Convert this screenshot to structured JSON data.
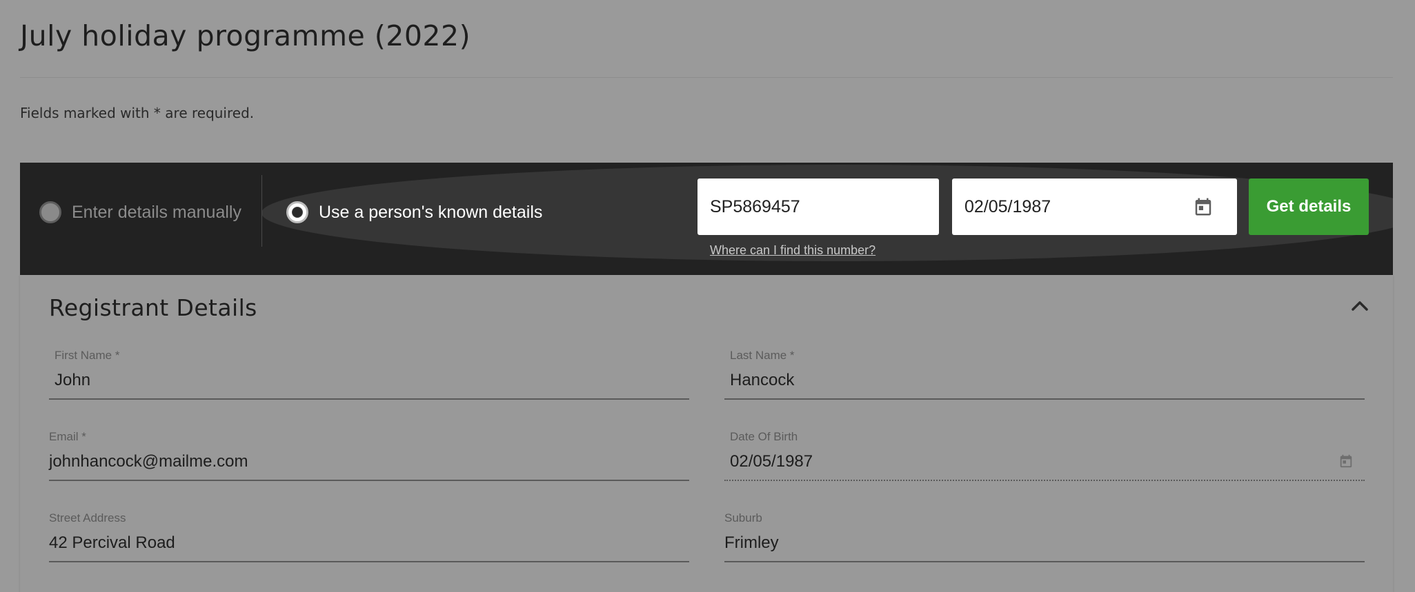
{
  "page": {
    "title": "July holiday programme (2022)",
    "required_note": "Fields marked with * are required."
  },
  "lookup": {
    "manual_option_label": "Enter details manually",
    "known_option_label": "Use a person's known details",
    "selected_option": "known",
    "id_number_value": "SP5869457",
    "dob_value": "02/05/1987",
    "help_link": "Where can I find this number?",
    "submit_label": "Get details",
    "calendar_icon": "calendar-icon"
  },
  "registrant": {
    "section_title": "Registrant Details",
    "collapse_icon": "chevron-up-icon",
    "fields": {
      "first_name": {
        "label": "First Name *",
        "value": "John"
      },
      "last_name": {
        "label": "Last Name *",
        "value": "Hancock"
      },
      "email": {
        "label": "Email *",
        "value": "johnhancock@mailme.com"
      },
      "dob": {
        "label": "Date Of Birth",
        "value": "02/05/1987"
      },
      "street": {
        "label": "Street Address",
        "value": "42 Percival Road"
      },
      "suburb": {
        "label": "Suburb",
        "value": "Frimley"
      }
    }
  },
  "colors": {
    "page_background": "#9a9a9a",
    "bar_background": "#222222",
    "button_green": "#3a9c33"
  }
}
